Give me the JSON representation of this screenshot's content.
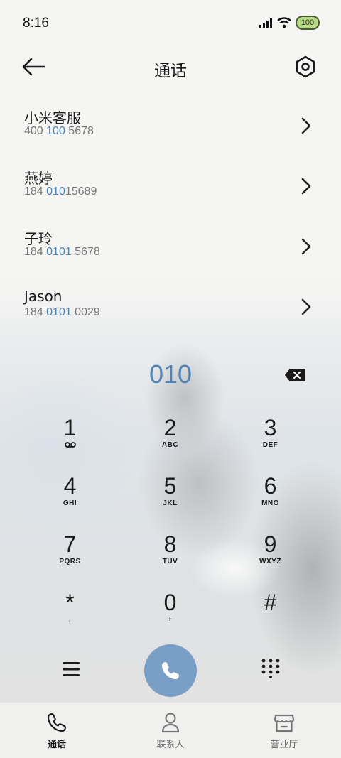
{
  "status_bar": {
    "time": "8:16",
    "battery": "100"
  },
  "header": {
    "title": "通话"
  },
  "contacts": [
    {
      "name": "小米客服",
      "number_parts": [
        "400 ",
        "100",
        " 5678"
      ]
    },
    {
      "name": "燕婷",
      "number_parts": [
        "184 ",
        "010",
        "15689"
      ]
    },
    {
      "name": "子玲",
      "number_parts": [
        "184 ",
        "0101",
        " 5678"
      ]
    },
    {
      "name": "Jason",
      "number_parts": [
        "184 ",
        "0101",
        " 0029"
      ]
    }
  ],
  "dialer": {
    "input": "010"
  },
  "keypad": [
    {
      "digit": "1",
      "sub": ""
    },
    {
      "digit": "2",
      "sub": "ABC"
    },
    {
      "digit": "3",
      "sub": "DEF"
    },
    {
      "digit": "4",
      "sub": "GHI"
    },
    {
      "digit": "5",
      "sub": "JKL"
    },
    {
      "digit": "6",
      "sub": "MNO"
    },
    {
      "digit": "7",
      "sub": "PQRS"
    },
    {
      "digit": "8",
      "sub": "TUV"
    },
    {
      "digit": "9",
      "sub": "WXYZ"
    },
    {
      "digit": "*",
      "sub": ","
    },
    {
      "digit": "0",
      "sub": "+"
    },
    {
      "digit": "#",
      "sub": ""
    }
  ],
  "bottom_nav": [
    {
      "label": "通话",
      "icon": "phone-icon",
      "active": true
    },
    {
      "label": "联系人",
      "icon": "person-icon",
      "active": false
    },
    {
      "label": "营业厅",
      "icon": "store-icon",
      "active": false
    }
  ],
  "colors": {
    "accent": "#4e83b6",
    "call_button": "#7a9fc7"
  }
}
